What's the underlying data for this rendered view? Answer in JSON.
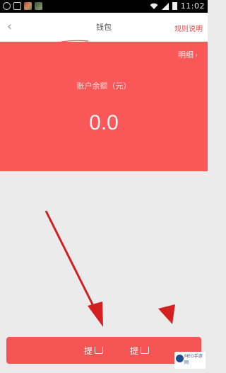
{
  "status_bar": {
    "time": "11:02",
    "left_icons": [
      "rotate-icon",
      "camera-icon",
      "app-thumbnail-icon",
      "app-thumbnail-icon"
    ],
    "right_icons": [
      "wifi-icon",
      "signal-icon",
      "battery-icon"
    ]
  },
  "nav": {
    "back_icon": "chevron-left-icon",
    "title": "钱包",
    "rules_label": "规则说明"
  },
  "balance": {
    "detail_label": "明细",
    "label": "账户余额（元）",
    "amount": "0.0"
  },
  "bottom_bar": {
    "left_button_label": "提",
    "right_button_label": "提"
  },
  "watermark": {
    "text": "MEO手游网"
  },
  "colors": {
    "brand_red": "#fa5758",
    "bar_red": "#f45454",
    "annotation_arrow": "#d42020"
  }
}
